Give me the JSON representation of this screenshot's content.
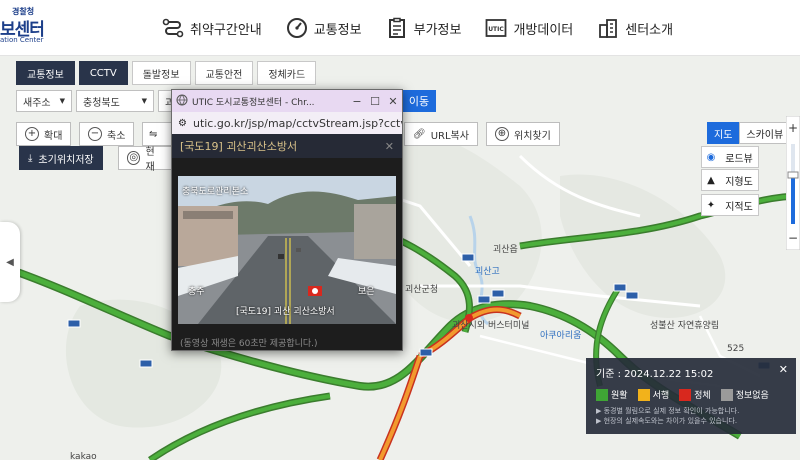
{
  "header": {
    "logo": {
      "line1": "경찰청",
      "line2": "보센터",
      "line3": "ation Center"
    },
    "nav": [
      {
        "label": "취약구간안내",
        "icon": "route-icon"
      },
      {
        "label": "교통정보",
        "icon": "gauge-icon"
      },
      {
        "label": "부가정보",
        "icon": "clipboard-icon"
      },
      {
        "label": "개방데이터",
        "icon": "utic-icon"
      },
      {
        "label": "센터소개",
        "icon": "building-icon"
      }
    ]
  },
  "tabs": [
    {
      "label": "교통정보",
      "active": true
    },
    {
      "label": "CCTV",
      "active": true
    },
    {
      "label": "돌발정보",
      "active": false
    },
    {
      "label": "교통안전",
      "active": false
    },
    {
      "label": "정체카드",
      "active": false
    }
  ],
  "filters": {
    "region1": "새주소",
    "region2": "충청북도",
    "region3": "괴",
    "go_label": "이동"
  },
  "map_buttons": {
    "zoom_in": "확대",
    "zoom_out": "축소",
    "url_copy": "URL복사",
    "find_location": "위치찾기",
    "save_initial": "초기위치저장",
    "current": "현재"
  },
  "map_type": {
    "map": "지도",
    "skyview": "스카이뷰",
    "roadview": "로드뷰",
    "terrain": "지형도",
    "cadastral": "지적도"
  },
  "map_labels": {
    "goesan_eup": "괴산읍",
    "goesan_county": "괴산군청",
    "school": "괴산고",
    "terminal": "괴산시외\n버스터미널",
    "ahyoung": "아쿠아리움",
    "nature": "성불산\n자연휴양림",
    "route_no": "525",
    "kakao": "kakao"
  },
  "popup": {
    "window_title": "UTIC 도시교통정보센터 - Chr...",
    "url": "utic.go.kr/jsp/map/cctvStream.jsp?cctvid=...",
    "cam_title": "[국도19] 괴산괴산소방서",
    "overlay_top": "충북도로관리본소",
    "overlay_left": "충주",
    "overlay_right": "보은",
    "overlay_bottom": "[국도19] 괴산 괴산소방서",
    "footer": "(동영상 재생은 60초만 제공합니다.)"
  },
  "legend": {
    "header": "기준 : 2024.12.22 15:02",
    "items": [
      {
        "label": "원활",
        "color": "#3fa535"
      },
      {
        "label": "서행",
        "color": "#f2b21b"
      },
      {
        "label": "정체",
        "color": "#d8281e"
      },
      {
        "label": "정보없음",
        "color": "#9a9a9a"
      }
    ],
    "notes": [
      "▶ 동경별 월림으로 실제 정보 확인이 가능합니다.",
      "▶ 현장의 실제속도와는 차이가 있을수 있습니다."
    ]
  }
}
